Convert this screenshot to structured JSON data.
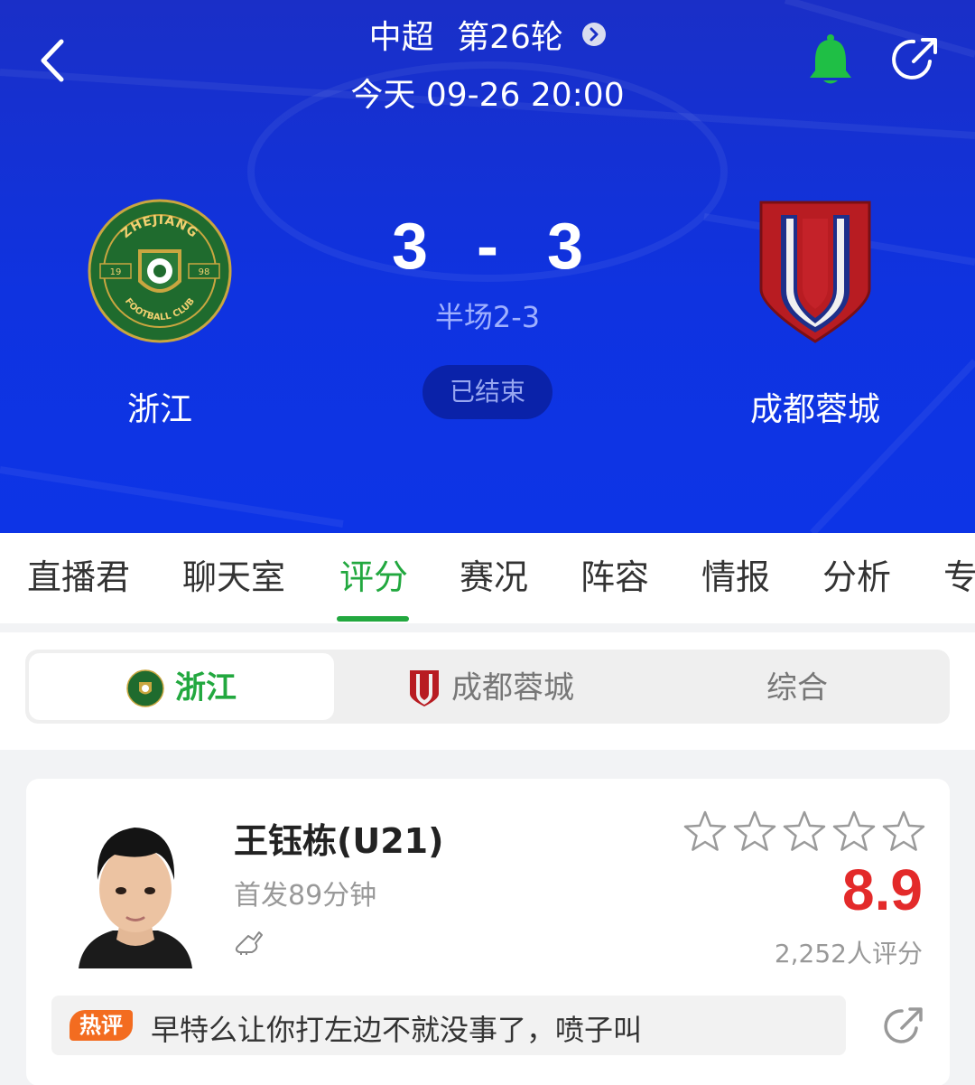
{
  "header": {
    "league": "中超",
    "round": "第26轮",
    "datetime": "今天 09-26 20:00",
    "home": {
      "name": "浙江",
      "crest_top": "ZHEJIANG",
      "crest_bottom": "FOOTBALL CLUB",
      "crest_left": "19",
      "crest_right": "98"
    },
    "away": {
      "name": "成都蓉城"
    },
    "score": {
      "home": "3",
      "separator": "-",
      "away": "3"
    },
    "half_time": "半场2-3",
    "status": "已结束"
  },
  "tabs": [
    "直播君",
    "聊天室",
    "评分",
    "赛况",
    "阵容",
    "情报",
    "分析",
    "专"
  ],
  "switcher": {
    "team1": "浙江",
    "team2": "成都蓉城",
    "combined": "综合"
  },
  "player": {
    "name": "王钰栋(U21)",
    "info": "首发89分钟",
    "rating": "8.9",
    "rating_count": "2,252人评分",
    "stars_filled": 0,
    "stars_total": 5
  },
  "comment": {
    "badge": "热评",
    "text": "早特么让你打左边不就没事了，喷子叫"
  },
  "colors": {
    "accent": "#22a83f",
    "header_blue": "#0f33e0",
    "rating_red": "#e32a2a",
    "hot_orange": "#f36c20"
  },
  "icons": [
    "back-icon",
    "chevron-right-icon",
    "bell-icon",
    "share-icon",
    "boot-icon",
    "star-icon"
  ]
}
